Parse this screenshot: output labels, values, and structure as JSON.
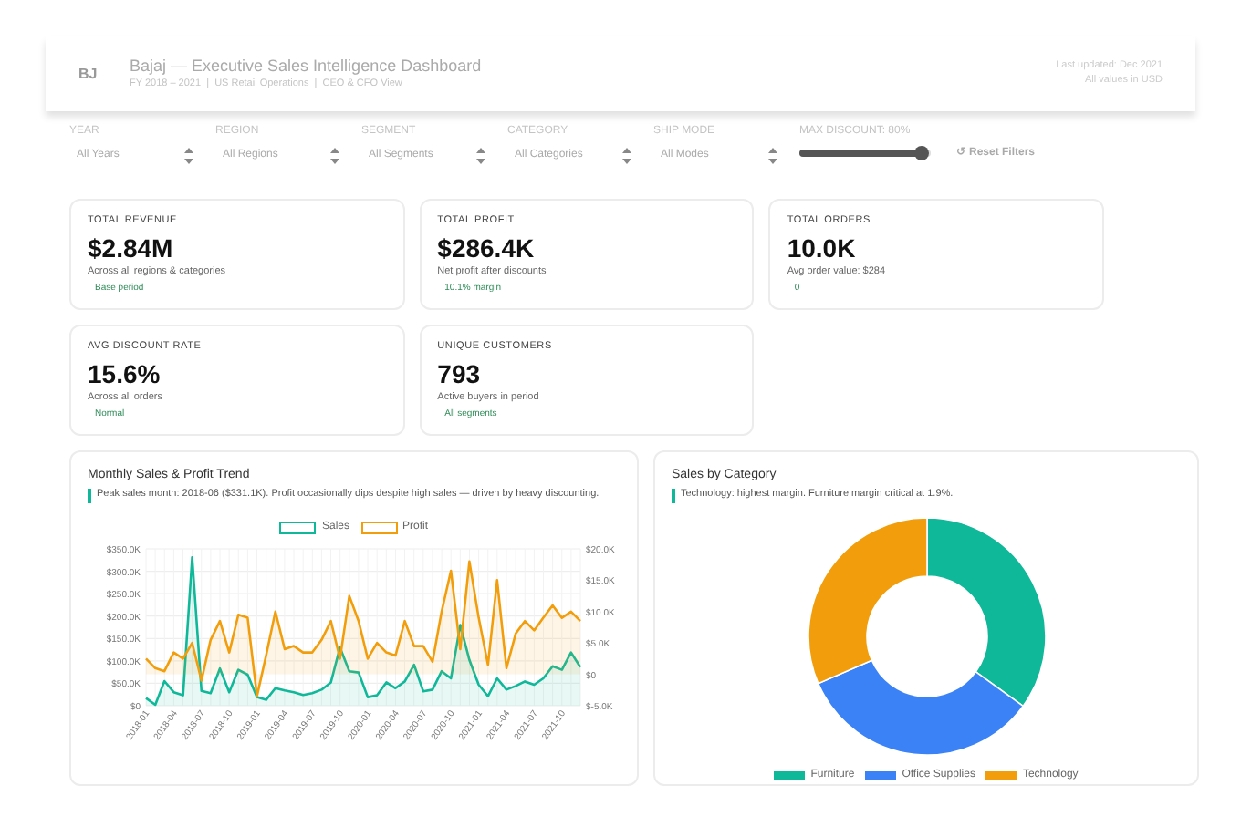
{
  "header": {
    "logo": "BJ",
    "title": "Bajaj — Executive Sales Intelligence Dashboard",
    "subtitle": "FY 2018 – 2021  |  US Retail Operations  |  CEO & CFO View",
    "updated": "Last updated: Dec 2021",
    "currency_note": "All values in USD"
  },
  "filters": [
    {
      "kind": "select",
      "label": "YEAR",
      "value": "All Years"
    },
    {
      "kind": "select",
      "label": "REGION",
      "value": "All Regions"
    },
    {
      "kind": "select",
      "label": "SEGMENT",
      "value": "All Segments"
    },
    {
      "kind": "select",
      "label": "CATEGORY",
      "value": "All Categories"
    },
    {
      "kind": "select",
      "label": "SHIP MODE",
      "value": "All Modes"
    },
    {
      "kind": "slider",
      "label": "MAX DISCOUNT: 80%",
      "level": 0.93
    }
  ],
  "reset_button": {
    "icon": "↺",
    "label": "Reset Filters"
  },
  "kpis": [
    {
      "label": "TOTAL REVENUE",
      "value": "$2.84M",
      "note": "Across all regions & categories",
      "badge": "Base period"
    },
    {
      "label": "TOTAL PROFIT",
      "value": "$286.4K",
      "note": "Net profit after discounts",
      "badge": "10.1% margin"
    },
    {
      "label": "TOTAL ORDERS",
      "value": "10.0K",
      "note": "Avg order value: $284",
      "badge": "0"
    },
    {
      "label": "AVG DISCOUNT RATE",
      "value": "15.6%",
      "note": "Across all orders",
      "badge": "Normal"
    },
    {
      "label": "UNIQUE CUSTOMERS",
      "value": "793",
      "note": "Active buyers in period",
      "badge": "All segments"
    }
  ],
  "trend_chart": {
    "title": "Monthly Sales & Profit Trend",
    "insight": "Peak sales month: 2018-06 ($331.1K). Profit occasionally dips despite high sales — driven by heavy discounting.",
    "chart_data": {
      "type": "area",
      "grid": true,
      "categories": [
        "2018-01",
        null,
        null,
        "2018-04",
        null,
        null,
        "2018-07",
        null,
        null,
        "2018-10",
        null,
        null,
        "2019-01",
        null,
        null,
        "2019-04",
        null,
        null,
        "2019-07",
        null,
        null,
        "2019-10",
        null,
        null,
        "2020-01",
        null,
        null,
        "2020-04",
        null,
        null,
        "2020-07",
        null,
        null,
        "2020-10",
        null,
        null,
        "2021-01",
        null,
        null,
        "2021-04",
        null,
        null,
        "2021-07",
        null,
        null,
        "2021-10",
        null,
        null
      ],
      "series": [
        {
          "name": "Sales",
          "color": "#10b89a",
          "values": [
            17,
            2,
            55,
            30,
            23,
            331,
            33,
            28,
            83,
            30,
            80,
            69,
            19,
            13,
            39,
            34,
            30,
            24,
            28,
            36,
            52,
            130,
            77,
            74,
            19,
            23,
            52,
            39,
            54,
            91,
            32,
            36,
            77,
            61,
            180,
            102,
            47,
            21,
            61,
            36,
            44,
            54,
            47,
            61,
            88,
            80,
            119,
            86
          ]
        }
      ],
      "ylim": [
        0,
        350
      ],
      "yticks": [
        {
          "value": 0,
          "label": "$0"
        },
        {
          "value": 50,
          "label": "$50.0K"
        },
        {
          "value": 100,
          "label": "$100.0K"
        },
        {
          "value": 150,
          "label": "$150.0K"
        },
        {
          "value": 200,
          "label": "$200.0K"
        },
        {
          "value": 250,
          "label": "$250.0K"
        },
        {
          "value": 300,
          "label": "$300.0K"
        },
        {
          "value": 350,
          "label": "$350.0K"
        }
      ]
    },
    "profit_overlay": {
      "chart_data": {
        "type": "area",
        "categories": [
          null,
          null,
          null,
          null,
          null,
          null,
          null,
          null,
          null,
          null,
          null,
          null,
          null,
          null,
          null,
          null,
          null,
          null,
          null,
          null,
          null,
          null,
          null,
          null,
          null,
          null,
          null,
          null,
          null,
          null,
          null,
          null,
          null,
          null,
          null,
          null,
          null,
          null,
          null,
          null,
          null,
          null,
          null,
          null,
          null,
          null,
          null,
          null
        ],
        "series": [
          {
            "name": "Profit",
            "color": "#f29e0c",
            "values": [
              2.5,
              1,
              0.5,
              3.5,
              2.5,
              5,
              -1,
              5.5,
              8.5,
              3.5,
              9.5,
              9,
              -3.5,
              3,
              10,
              4,
              4.5,
              3.5,
              3.5,
              5.5,
              8.5,
              2.5,
              12.5,
              8.5,
              2.5,
              5,
              3.5,
              3,
              8.5,
              4.5,
              4.5,
              2,
              10,
              16.5,
              4,
              18,
              9,
              1.5,
              15,
              1,
              6.5,
              8.5,
              7,
              9,
              11,
              9,
              10,
              8.5
            ]
          }
        ],
        "ylim": [
          -5,
          20
        ],
        "yticks": [
          {
            "value": -5,
            "label": "$-5.0K"
          },
          {
            "value": 0,
            "label": "$0"
          },
          {
            "value": 5,
            "label": "$5.0K"
          },
          {
            "value": 10,
            "label": "$10.0K"
          },
          {
            "value": 15,
            "label": "$15.0K"
          },
          {
            "value": 20,
            "label": "$20.0K"
          }
        ]
      }
    }
  },
  "category_chart": {
    "title": "Sales by Category",
    "insight": "Technology: highest margin. Furniture margin critical at 1.9%.",
    "chart_data": {
      "type": "donut",
      "categories": [
        "Furniture",
        "Office Supplies",
        "Technology"
      ],
      "series": [
        {
          "values": [
            0.35,
            0.335,
            0.315
          ]
        }
      ],
      "colors": [
        "#10b89a",
        "#3b82f6",
        "#f29e0c"
      ]
    }
  }
}
